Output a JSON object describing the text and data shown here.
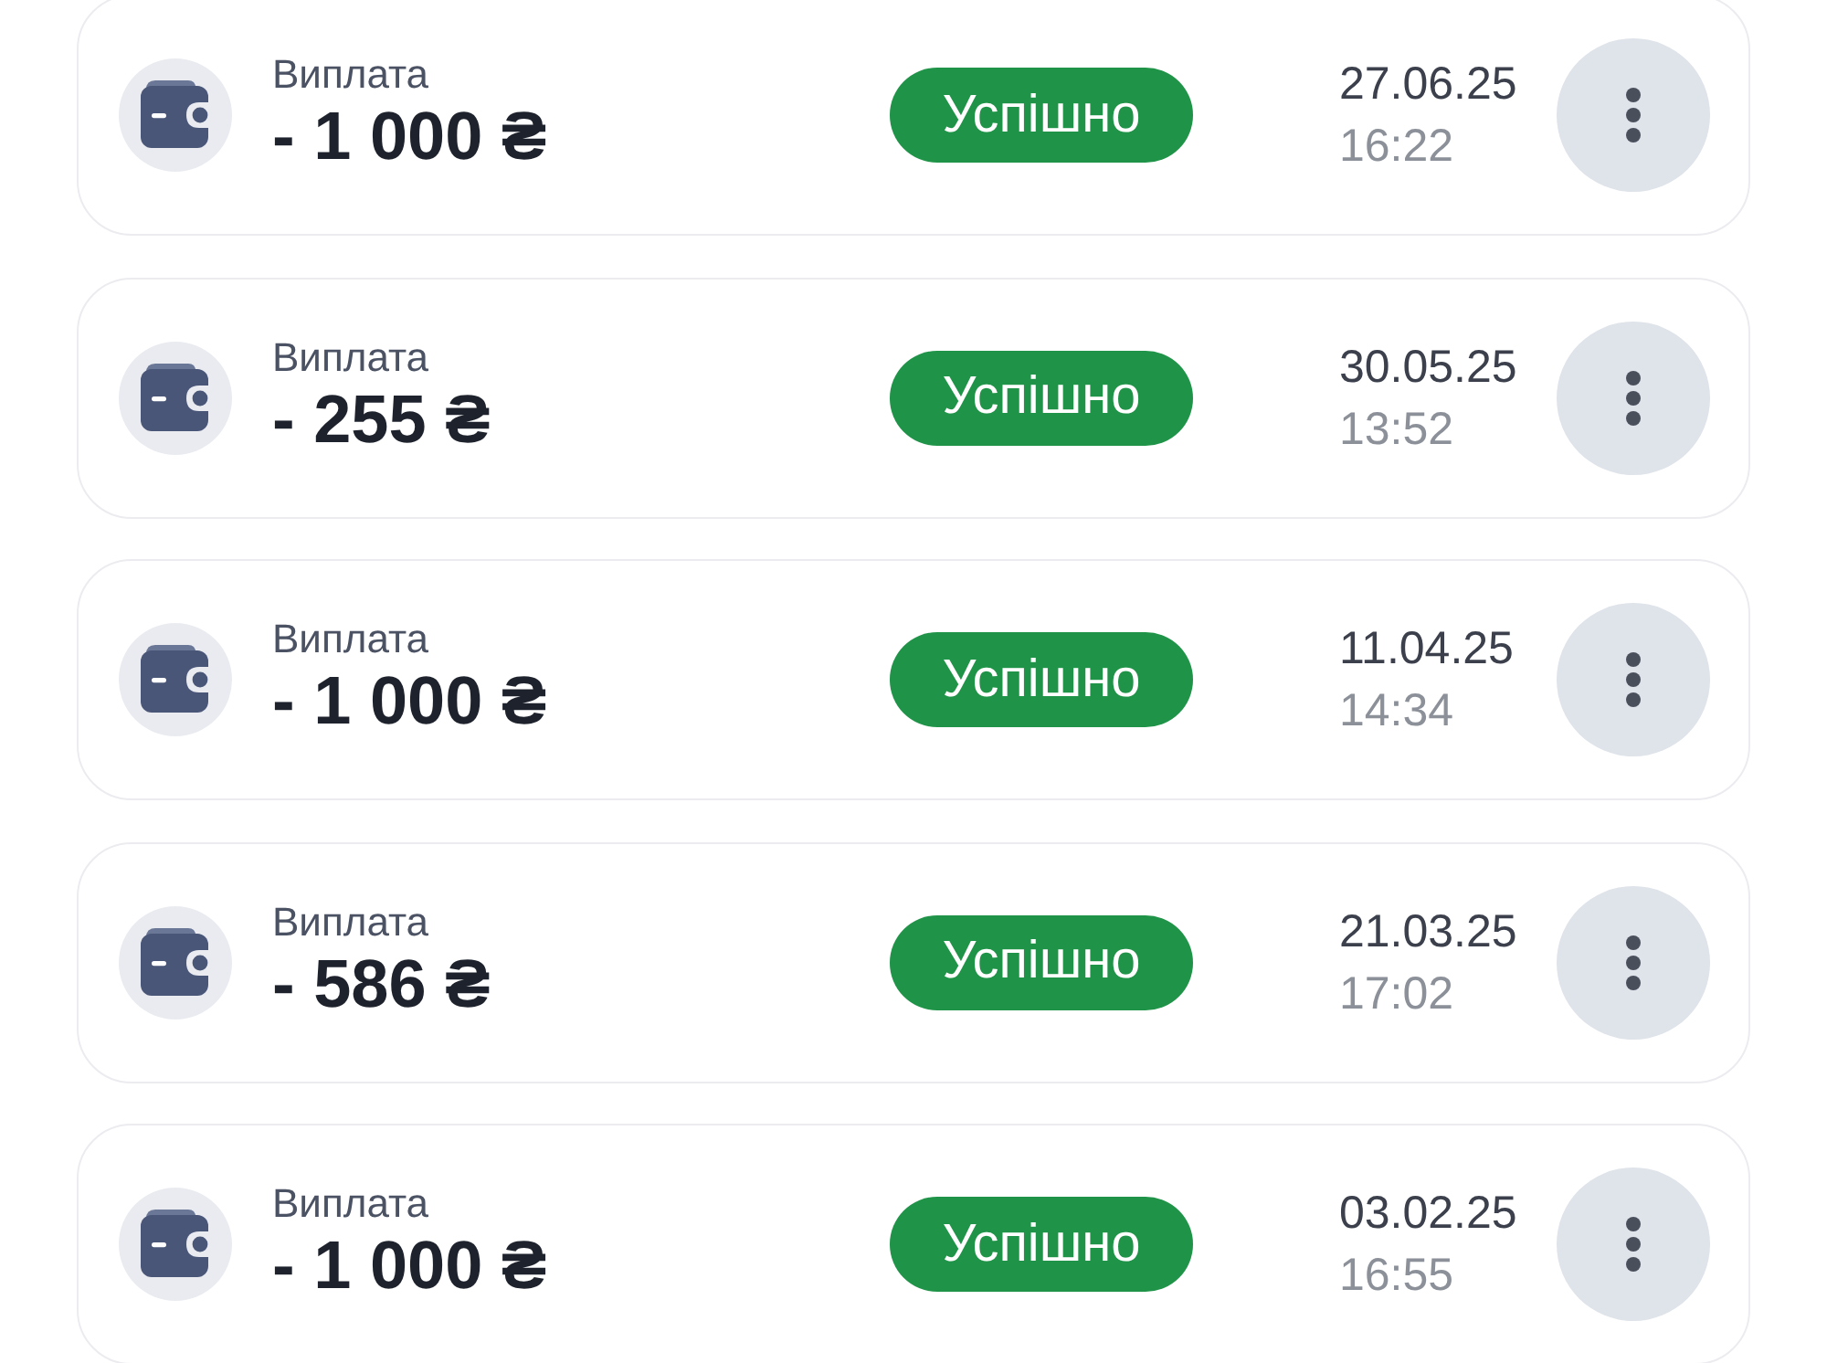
{
  "transactions": [
    {
      "title": "Виплата",
      "amount": "- 1 000 ₴",
      "status": "Успішно",
      "date": "27.06.25",
      "time": "16:22"
    },
    {
      "title": "Виплата",
      "amount": "- 255 ₴",
      "status": "Успішно",
      "date": "30.05.25",
      "time": "13:52"
    },
    {
      "title": "Виплата",
      "amount": "- 1 000 ₴",
      "status": "Успішно",
      "date": "11.04.25",
      "time": "14:34"
    },
    {
      "title": "Виплата",
      "amount": "- 586 ₴",
      "status": "Успішно",
      "date": "21.03.25",
      "time": "17:02"
    },
    {
      "title": "Виплата",
      "amount": "- 1 000 ₴",
      "status": "Успішно",
      "date": "03.02.25",
      "time": "16:55"
    }
  ]
}
